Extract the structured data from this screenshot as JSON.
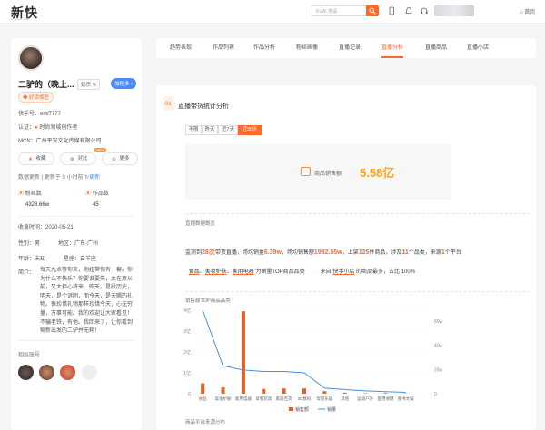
{
  "header": {
    "logo": "新快",
    "logo_sub": "XINKUAI.COM",
    "search_placeholder": "KUAI 类请",
    "home_label": "首页"
  },
  "profile": {
    "name": "二驴的（晚上...",
    "category_tag": "娱乐",
    "follow_button": "加粉多",
    "badge": "好货榜匠",
    "kuaishou_id": "快手号：erlv7777",
    "certification_label": "认证：",
    "certification": "时尚领域创作者",
    "mcn": "MCN：广州平安文化传媒有限公司",
    "actions": {
      "collect": "收藏",
      "compare": "对比",
      "more": "更多",
      "new_badge": "NEW"
    },
    "data_update": "数据更新 | 更新于 9 小时前",
    "refresh": "更新",
    "fans_label": "粉丝数",
    "fans_value": "4328.66w",
    "works_label": "作品数",
    "works_value": "45",
    "record_label": "收录时间：",
    "record_date": "2020-05-21",
    "gender_label": "性别：",
    "gender": "男",
    "region_label": "地区：",
    "region": "广东·广州",
    "age_label": "年龄：",
    "age": "未知",
    "zodiac_label": "星座：",
    "zodiac": "白羊座",
    "bio_label": "简介：",
    "bio": "每天九点等你来，泡妞带你有一套。你为什么不快乐？你要谁要失，太在意从前，又太担心将来。昨天，是段历史，明天，是个谜团，而今天，是天赐的礼物。像珍惜礼物那样珍惜今天，心无穷量，万事可能。我的欢迎让大家看见！不骗老铁，有他。我回来了，让你看到崭新出发的二驴并无耗！",
    "related_label": "相似账号"
  },
  "tabs": [
    "趋势表现",
    "作品列表",
    "作品分析",
    "粉丝画像",
    "直播记录",
    "直播分析",
    "直播商品",
    "直播小店"
  ],
  "active_tab": "直播分析",
  "section": {
    "number": "01",
    "title": "直播带货统计分析",
    "ranges": [
      "不限",
      "昨天",
      "近7天",
      "近30天"
    ],
    "active_range": "近30天",
    "gmv_label": "商品销售额",
    "gmv_value": "5.58亿",
    "overview_label": "直播数据概览",
    "summary": {
      "p1": "监测到",
      "live_count": "28次",
      "p2": "带货直播，场均销量",
      "avg_sales": "6.39w",
      "p3": "，场均销售额",
      "avg_gmv": "1992.55w",
      "p4": "，上架",
      "goods_count": "125",
      "p5": "件商品，涉及",
      "cat_count": "11",
      "p6": "个品类，来源",
      "src_count": "1",
      "p7": "个平台"
    },
    "summary2": {
      "c1": "食品",
      "c2": "美妆护肤",
      "c3": "家用电器",
      "t1": "为销量TOP商品品类",
      "t2": "来自",
      "shop": "快手小店",
      "t3": "的商品最多，占比 100%"
    },
    "chart_label": "销售额TOP商品品类",
    "platform_label": "商品平台来源分布"
  },
  "chart_data": {
    "type": "bar",
    "categories": [
      "食品",
      "美妆护肤",
      "家用电器",
      "母婴玩具",
      "家居百货",
      "3C数码",
      "母婴乐器",
      "其他",
      "运动户外",
      "医用保健",
      "图书文娱"
    ],
    "series": [
      {
        "name": "销售额",
        "values": [
          0.5,
          0.3,
          3.95,
          0.23,
          0.25,
          0.25,
          0.12,
          0.05,
          0.02,
          0.03,
          0.01
        ],
        "color": "#ef5b1c"
      },
      {
        "name": "销量",
        "values": [
          60,
          20,
          17,
          16,
          16,
          15,
          4,
          3,
          2,
          1.5,
          1
        ],
        "color": "#4a90e2"
      }
    ],
    "y_left_ticks": [
      "4亿",
      "3亿",
      "2亿",
      "1亿",
      "0"
    ],
    "y_right_ticks": [
      "60w",
      "40w",
      "20w",
      "0"
    ],
    "ylim_left": [
      0,
      4
    ],
    "ylim_right": [
      0,
      60
    ]
  },
  "colors": {
    "accent": "#ff6a2b",
    "gmv": "#ffa31a",
    "blue": "#4a8cf7"
  }
}
